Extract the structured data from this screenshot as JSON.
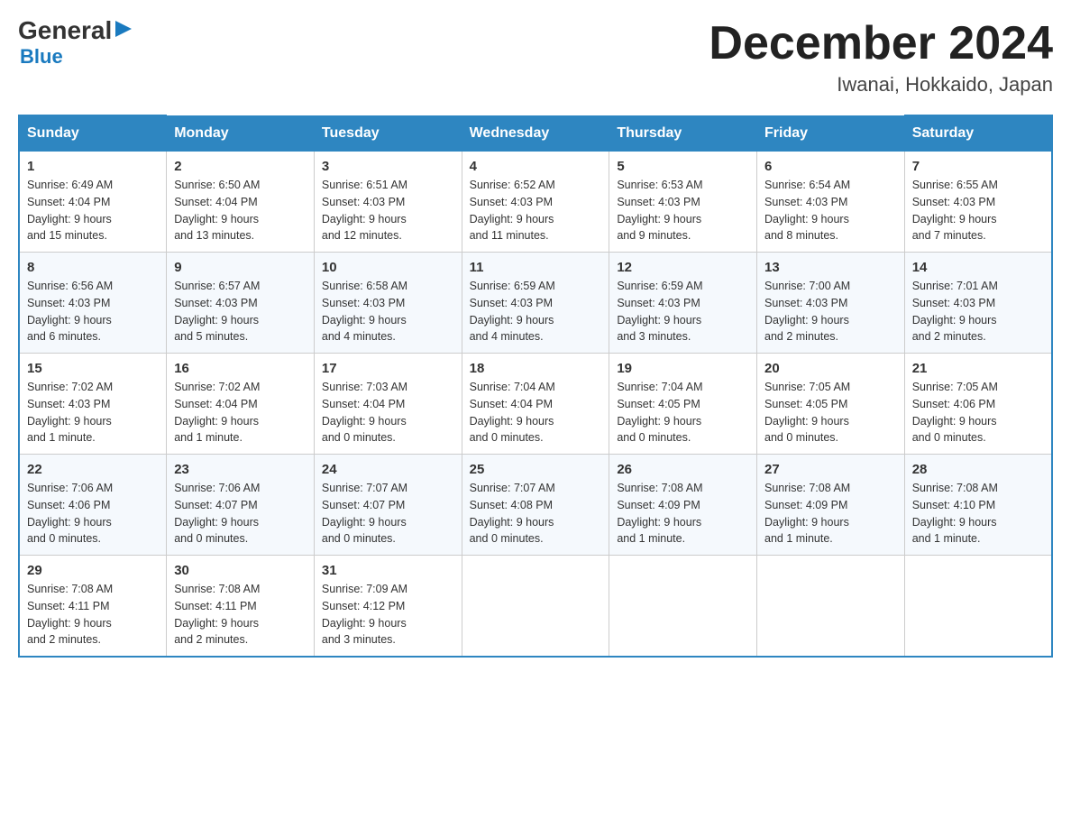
{
  "header": {
    "logo_general": "General",
    "logo_blue": "Blue",
    "month_title": "December 2024",
    "location": "Iwanai, Hokkaido, Japan"
  },
  "weekdays": [
    "Sunday",
    "Monday",
    "Tuesday",
    "Wednesday",
    "Thursday",
    "Friday",
    "Saturday"
  ],
  "weeks": [
    [
      {
        "day": "1",
        "info": "Sunrise: 6:49 AM\nSunset: 4:04 PM\nDaylight: 9 hours\nand 15 minutes."
      },
      {
        "day": "2",
        "info": "Sunrise: 6:50 AM\nSunset: 4:04 PM\nDaylight: 9 hours\nand 13 minutes."
      },
      {
        "day": "3",
        "info": "Sunrise: 6:51 AM\nSunset: 4:03 PM\nDaylight: 9 hours\nand 12 minutes."
      },
      {
        "day": "4",
        "info": "Sunrise: 6:52 AM\nSunset: 4:03 PM\nDaylight: 9 hours\nand 11 minutes."
      },
      {
        "day": "5",
        "info": "Sunrise: 6:53 AM\nSunset: 4:03 PM\nDaylight: 9 hours\nand 9 minutes."
      },
      {
        "day": "6",
        "info": "Sunrise: 6:54 AM\nSunset: 4:03 PM\nDaylight: 9 hours\nand 8 minutes."
      },
      {
        "day": "7",
        "info": "Sunrise: 6:55 AM\nSunset: 4:03 PM\nDaylight: 9 hours\nand 7 minutes."
      }
    ],
    [
      {
        "day": "8",
        "info": "Sunrise: 6:56 AM\nSunset: 4:03 PM\nDaylight: 9 hours\nand 6 minutes."
      },
      {
        "day": "9",
        "info": "Sunrise: 6:57 AM\nSunset: 4:03 PM\nDaylight: 9 hours\nand 5 minutes."
      },
      {
        "day": "10",
        "info": "Sunrise: 6:58 AM\nSunset: 4:03 PM\nDaylight: 9 hours\nand 4 minutes."
      },
      {
        "day": "11",
        "info": "Sunrise: 6:59 AM\nSunset: 4:03 PM\nDaylight: 9 hours\nand 4 minutes."
      },
      {
        "day": "12",
        "info": "Sunrise: 6:59 AM\nSunset: 4:03 PM\nDaylight: 9 hours\nand 3 minutes."
      },
      {
        "day": "13",
        "info": "Sunrise: 7:00 AM\nSunset: 4:03 PM\nDaylight: 9 hours\nand 2 minutes."
      },
      {
        "day": "14",
        "info": "Sunrise: 7:01 AM\nSunset: 4:03 PM\nDaylight: 9 hours\nand 2 minutes."
      }
    ],
    [
      {
        "day": "15",
        "info": "Sunrise: 7:02 AM\nSunset: 4:03 PM\nDaylight: 9 hours\nand 1 minute."
      },
      {
        "day": "16",
        "info": "Sunrise: 7:02 AM\nSunset: 4:04 PM\nDaylight: 9 hours\nand 1 minute."
      },
      {
        "day": "17",
        "info": "Sunrise: 7:03 AM\nSunset: 4:04 PM\nDaylight: 9 hours\nand 0 minutes."
      },
      {
        "day": "18",
        "info": "Sunrise: 7:04 AM\nSunset: 4:04 PM\nDaylight: 9 hours\nand 0 minutes."
      },
      {
        "day": "19",
        "info": "Sunrise: 7:04 AM\nSunset: 4:05 PM\nDaylight: 9 hours\nand 0 minutes."
      },
      {
        "day": "20",
        "info": "Sunrise: 7:05 AM\nSunset: 4:05 PM\nDaylight: 9 hours\nand 0 minutes."
      },
      {
        "day": "21",
        "info": "Sunrise: 7:05 AM\nSunset: 4:06 PM\nDaylight: 9 hours\nand 0 minutes."
      }
    ],
    [
      {
        "day": "22",
        "info": "Sunrise: 7:06 AM\nSunset: 4:06 PM\nDaylight: 9 hours\nand 0 minutes."
      },
      {
        "day": "23",
        "info": "Sunrise: 7:06 AM\nSunset: 4:07 PM\nDaylight: 9 hours\nand 0 minutes."
      },
      {
        "day": "24",
        "info": "Sunrise: 7:07 AM\nSunset: 4:07 PM\nDaylight: 9 hours\nand 0 minutes."
      },
      {
        "day": "25",
        "info": "Sunrise: 7:07 AM\nSunset: 4:08 PM\nDaylight: 9 hours\nand 0 minutes."
      },
      {
        "day": "26",
        "info": "Sunrise: 7:08 AM\nSunset: 4:09 PM\nDaylight: 9 hours\nand 1 minute."
      },
      {
        "day": "27",
        "info": "Sunrise: 7:08 AM\nSunset: 4:09 PM\nDaylight: 9 hours\nand 1 minute."
      },
      {
        "day": "28",
        "info": "Sunrise: 7:08 AM\nSunset: 4:10 PM\nDaylight: 9 hours\nand 1 minute."
      }
    ],
    [
      {
        "day": "29",
        "info": "Sunrise: 7:08 AM\nSunset: 4:11 PM\nDaylight: 9 hours\nand 2 minutes."
      },
      {
        "day": "30",
        "info": "Sunrise: 7:08 AM\nSunset: 4:11 PM\nDaylight: 9 hours\nand 2 minutes."
      },
      {
        "day": "31",
        "info": "Sunrise: 7:09 AM\nSunset: 4:12 PM\nDaylight: 9 hours\nand 3 minutes."
      },
      {
        "day": "",
        "info": ""
      },
      {
        "day": "",
        "info": ""
      },
      {
        "day": "",
        "info": ""
      },
      {
        "day": "",
        "info": ""
      }
    ]
  ]
}
